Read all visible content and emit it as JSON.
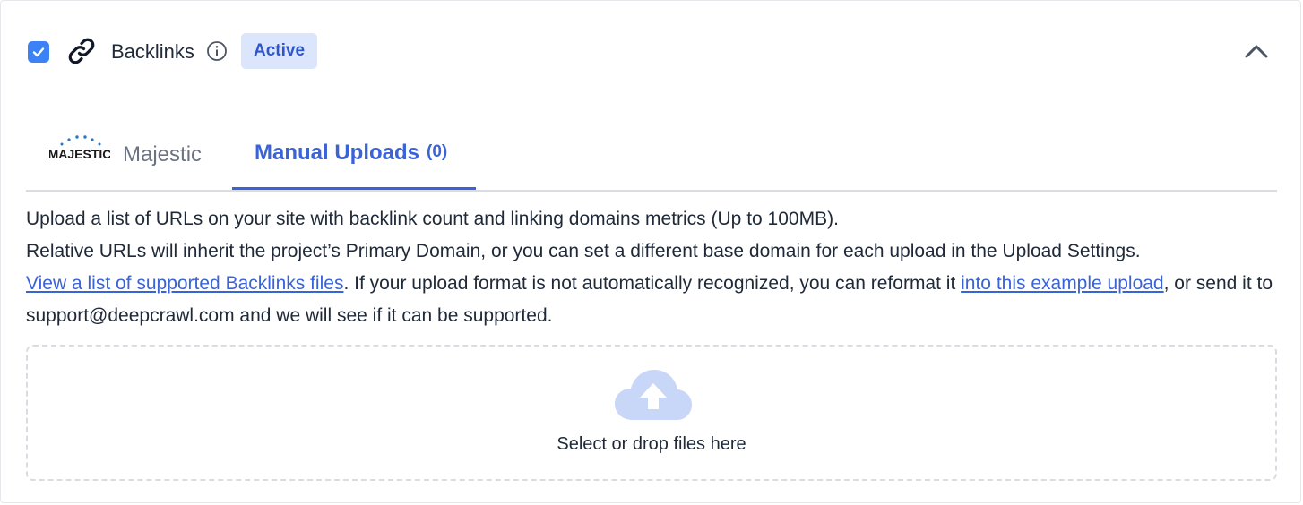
{
  "section": {
    "title": "Backlinks",
    "status_badge": "Active",
    "checked": true
  },
  "tabs": {
    "majestic": {
      "logo_text": "MAJESTIC",
      "label": "Majestic"
    },
    "manual": {
      "label": "Manual Uploads",
      "count": "(0)",
      "active": true
    }
  },
  "description": {
    "line1": "Upload a list of URLs on your site with backlink count and linking domains metrics (Up to 100MB).",
    "line2": "Relative URLs will inherit the project’s Primary Domain, or you can set a different base domain for each upload in the Upload Settings.",
    "link_supported_files": "View a list of supported Backlinks files",
    "text_reformat": ". If your upload format is not automatically recognized, you can reformat it ",
    "link_example_upload": "into this example upload",
    "text_support": ", or send it to support@deepcrawl.com and we will see if it can be supported."
  },
  "dropzone": {
    "label": "Select or drop files here",
    "icon": "cloud-upload-icon"
  },
  "colors": {
    "accent": "#3b63d8",
    "checkbox": "#3b82f6",
    "badge_bg": "#dbe5fb",
    "cloud": "#c8d6f7"
  }
}
